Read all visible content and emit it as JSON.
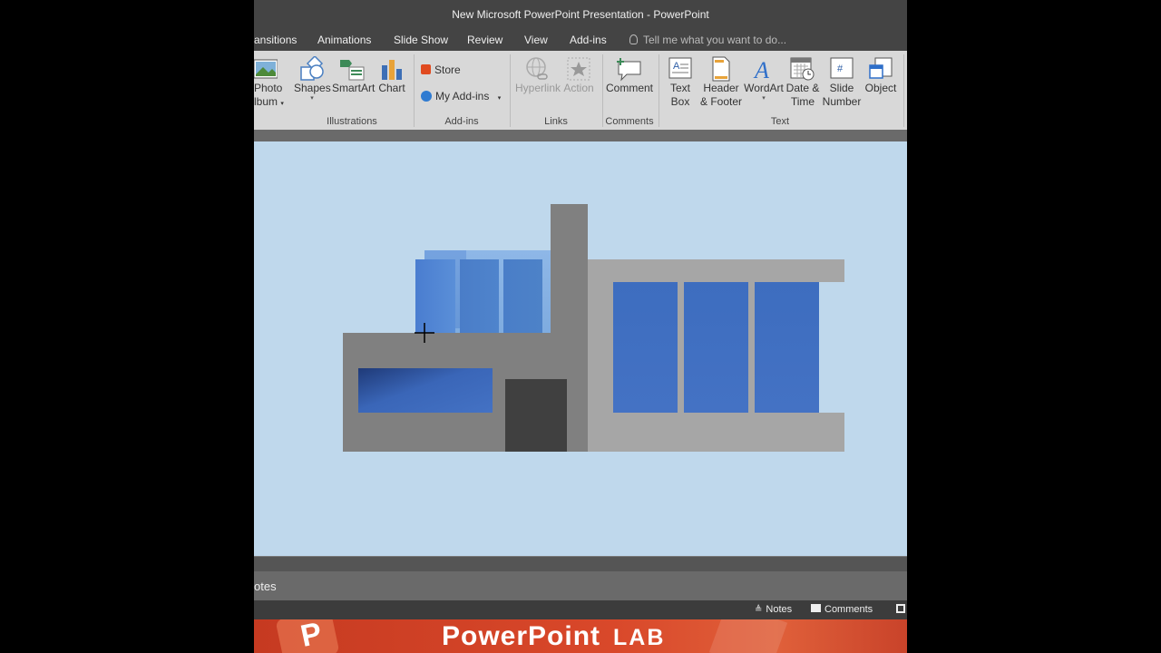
{
  "window": {
    "title": "New Microsoft PowerPoint Presentation - PowerPoint"
  },
  "tabs": [
    "ansitions",
    "Animations",
    "Slide Show",
    "Review",
    "View",
    "Add-ins"
  ],
  "tell_me": "Tell me what you want to do...",
  "ribbon": {
    "photo_album": {
      "line1": "Photo",
      "line2": "lbum"
    },
    "shapes": "Shapes",
    "smartart": "SmartArt",
    "chart": "Chart",
    "store": "Store",
    "my_addins": "My Add-ins",
    "hyperlink": "Hyperlink",
    "action": "Action",
    "comment": "Comment",
    "text_box": {
      "line1": "Text",
      "line2": "Box"
    },
    "header_footer": {
      "line1": "Header",
      "line2": "& Footer"
    },
    "wordart": "WordArt",
    "date_time": {
      "line1": "Date &",
      "line2": "Time"
    },
    "slide_number": {
      "line1": "Slide",
      "line2": "Number"
    },
    "object": "Object",
    "groups": {
      "illustrations": "Illustrations",
      "addins": "Add-ins",
      "links": "Links",
      "comments": "Comments",
      "text": "Text"
    }
  },
  "notes_pane": {
    "label": "otes"
  },
  "status": {
    "notes": "Notes",
    "comments": "Comments"
  },
  "banner": {
    "title": "PowerPoint",
    "lab": "LAB",
    "logo_letter": "P"
  },
  "colors": {
    "slide_bg": "#bfd8ec",
    "wall_dark": "#808080",
    "wall_light": "#a6a6a6",
    "window_blue": "#4472c4",
    "door": "#404040",
    "banner_red": "#d24726"
  }
}
